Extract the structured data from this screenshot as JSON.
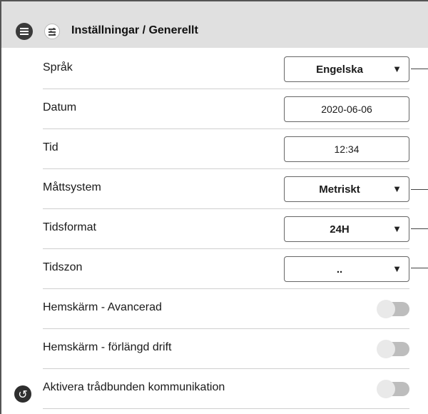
{
  "header": {
    "title": "Inställningar / Generellt"
  },
  "rows": [
    {
      "label": "Språk",
      "type": "select",
      "value": "Engelska"
    },
    {
      "label": "Datum",
      "type": "field",
      "value": "2020-06-06"
    },
    {
      "label": "Tid",
      "type": "field",
      "value": "12:34"
    },
    {
      "label": "Måttsystem",
      "type": "select",
      "value": "Metriskt"
    },
    {
      "label": "Tidsformat",
      "type": "select",
      "value": "24H"
    },
    {
      "label": "Tidszon",
      "type": "select",
      "value": ".."
    },
    {
      "label": "Hemskärm - Avancerad",
      "type": "toggle",
      "on": false
    },
    {
      "label": "Hemskärm - förlängd drift",
      "type": "toggle",
      "on": false
    },
    {
      "label": "Aktivera trådbunden kommunikation",
      "type": "toggle",
      "on": false
    }
  ],
  "icons": {
    "menu": "menu-icon",
    "settings": "sliders-icon",
    "back": "back-icon",
    "dropdown": "chevron-down-icon"
  },
  "glyphs": {
    "dropdown_arrow": "▼",
    "back_arrow": "↺"
  }
}
